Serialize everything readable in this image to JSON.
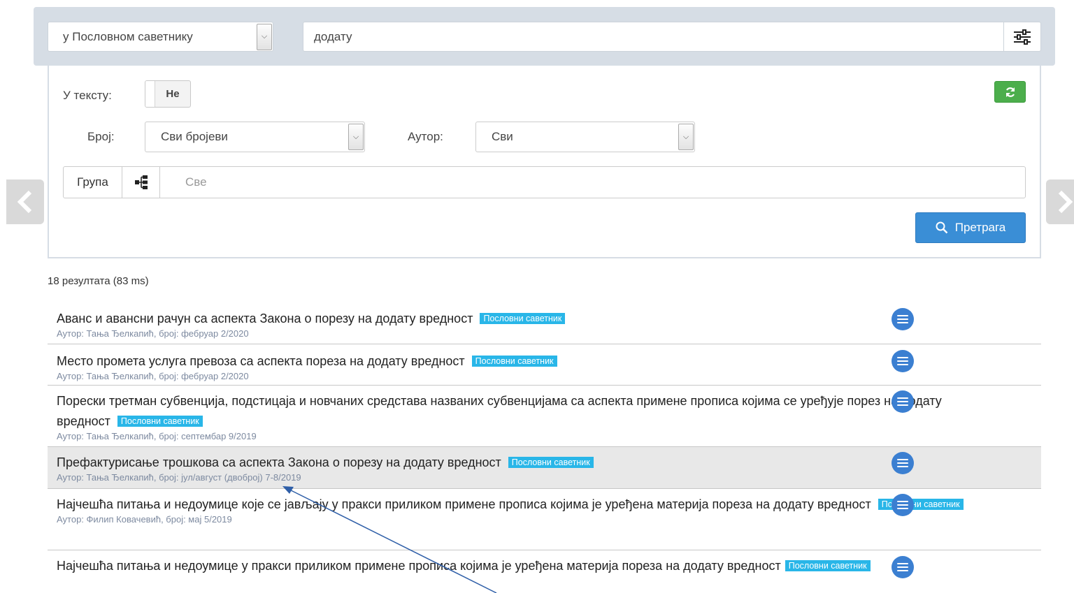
{
  "search": {
    "scope": "у Пословном саветнику",
    "query": "додату"
  },
  "filters": {
    "in_text_label": "У тексту:",
    "in_text_value": "Не",
    "number_label": "Број:",
    "number_value": "Сви бројеви",
    "author_label": "Аутор:",
    "author_value": "Сви",
    "group_label": "Група",
    "group_placeholder": "Све",
    "search_button": "Претрага"
  },
  "results_count": "18 резултата (83 ms)",
  "results": [
    {
      "title": "Аванс и авансни рачун са аспекта Закона о порезу на додату вредност",
      "badge": "Пословни саветник",
      "meta": "Аутор: Тања Ђелкапић, број: фебруар 2/2020"
    },
    {
      "title": "Место промета услуга превоза са аспекта пореза на додату вредност",
      "badge": "Пословни саветник",
      "meta": "Аутор: Тања Ђелкапић, број: фебруар 2/2020"
    },
    {
      "title": "Порески третман субвенција, подстицаја и новчаних средстава названих субвенцијама са аспекта примене прописа којима се уређује порез на додату вредност",
      "badge": "Пословни саветник",
      "meta": "Аутор: Тања Ђелкапић, број: септембар 9/2019"
    },
    {
      "title": "Префактурисање трошкова са аспекта Закона о порезу на додату вредност",
      "badge": "Пословни саветник",
      "meta": "Аутор: Тања Ђелкапић, број: јул/август (двоброј) 7-8/2019"
    },
    {
      "title": "Најчешћа питања и недоумице које се јављају у пракси приликом примене прописа којима је уређена материја пореза на додату вредност",
      "badge": "Пословни саветник",
      "meta": "Аутор: Филип Ковачевић, број: мај 5/2019"
    },
    {
      "title": "Најчешћа питања и недоумице у пракси приликом примене прописа којима је уређена материја пореза на додату вредност",
      "badge": "Пословни саветник",
      "meta": ""
    }
  ],
  "colors": {
    "badge": "#29b6e8",
    "search_button": "#3a8ed6",
    "refresh_button": "#4cae4c",
    "menu_button": "#3b7fd1",
    "annotation_arrow": "#2f5fa8"
  },
  "icons": {
    "filter": "sliders-icon",
    "refresh": "refresh-icon",
    "group": "sitemap-icon",
    "search": "search-icon",
    "prev": "chevron-left-icon",
    "next": "chevron-right-icon",
    "row_menu": "list-menu-icon"
  }
}
